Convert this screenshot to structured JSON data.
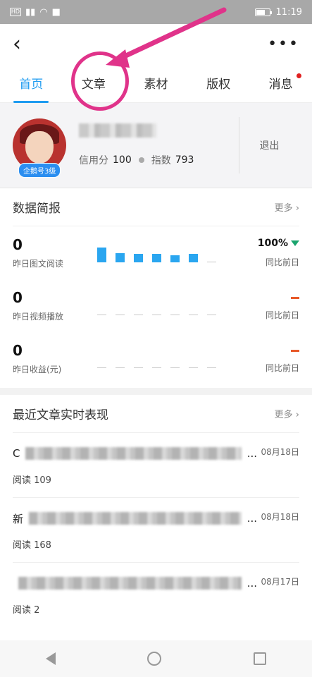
{
  "status": {
    "time": "11:19"
  },
  "nav": {
    "tabs": [
      "首页",
      "文章",
      "素材",
      "版权",
      "消息"
    ]
  },
  "profile": {
    "badge": "企鹅号3级",
    "credit_label": "信用分",
    "credit": "100",
    "index_label": "指数",
    "index": "793",
    "logout": "退出"
  },
  "overview": {
    "title": "数据简报",
    "more": "更多",
    "stats": [
      {
        "value": "0",
        "label": "昨日图文阅读",
        "change": "100%",
        "compare": "同比前日"
      },
      {
        "value": "0",
        "label": "昨日视频播放",
        "change": "",
        "compare": "同比前日"
      },
      {
        "value": "0",
        "label": "昨日收益(元)",
        "change": "",
        "compare": "同比前日"
      }
    ],
    "bar_levels": [
      0.8,
      0.5,
      0.45,
      0.45,
      0.4,
      0.45
    ]
  },
  "recent": {
    "title": "最近文章实时表现",
    "more": "更多",
    "articles": [
      {
        "prefix": "C",
        "suffix": "...",
        "date": "08月18日",
        "read": "阅读 109"
      },
      {
        "prefix": "新",
        "suffix": "...",
        "date": "08月18日",
        "read": "阅读 168"
      },
      {
        "prefix": "",
        "suffix": "...",
        "date": "08月17日",
        "read": "阅读 2"
      }
    ]
  },
  "colors": {
    "accent": "#1e9bf0",
    "annotation": "#e0338a"
  }
}
